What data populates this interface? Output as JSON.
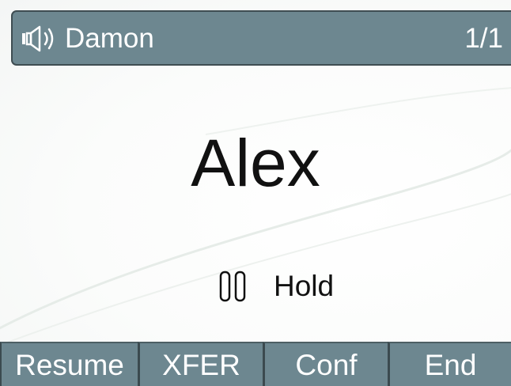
{
  "header": {
    "caller": "Damon",
    "line_count": "1/1",
    "icon": "speaker-icon"
  },
  "call": {
    "callee": "Alex",
    "status_label": "Hold",
    "status_icon": "pause-icon"
  },
  "softkeys": [
    {
      "label": "Resume"
    },
    {
      "label": "XFER"
    },
    {
      "label": "Conf"
    },
    {
      "label": "End"
    }
  ],
  "colors": {
    "bar": "#6d8790",
    "bar_border": "#3f4d52",
    "background": "#ffffff",
    "text": "#111111"
  }
}
